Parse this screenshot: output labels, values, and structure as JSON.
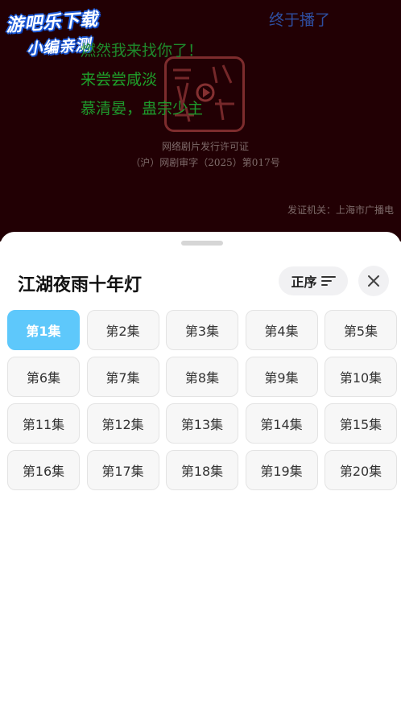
{
  "video": {
    "watermark_line1": "游吧乐下载",
    "watermark_line2": "小编亲测",
    "danmu": [
      "终于播了",
      "燃然我来找你了！",
      "来尝尝咸淡",
      "慕清晏，蛊宗少主"
    ],
    "license_line1": "网络剧片发行许可证",
    "license_line2": "（沪）网剧审字（2025）第017号",
    "authority": "发证机关：上海市广播电"
  },
  "sheet": {
    "title": "江湖夜雨十年灯",
    "sort_label": "正序",
    "selected_episode": 1,
    "episodes": [
      {
        "label": "第1集"
      },
      {
        "label": "第2集"
      },
      {
        "label": "第3集"
      },
      {
        "label": "第4集"
      },
      {
        "label": "第5集"
      },
      {
        "label": "第6集"
      },
      {
        "label": "第7集"
      },
      {
        "label": "第8集"
      },
      {
        "label": "第9集"
      },
      {
        "label": "第10集"
      },
      {
        "label": "第11集"
      },
      {
        "label": "第12集"
      },
      {
        "label": "第13集"
      },
      {
        "label": "第14集"
      },
      {
        "label": "第15集"
      },
      {
        "label": "第16集"
      },
      {
        "label": "第17集"
      },
      {
        "label": "第18集"
      },
      {
        "label": "第19集"
      },
      {
        "label": "第20集"
      }
    ]
  },
  "colors": {
    "accent": "#5ec8fb",
    "video_bg": "#220004"
  },
  "icons": {
    "sort": "sort-lines-icon",
    "close": "close-icon"
  }
}
